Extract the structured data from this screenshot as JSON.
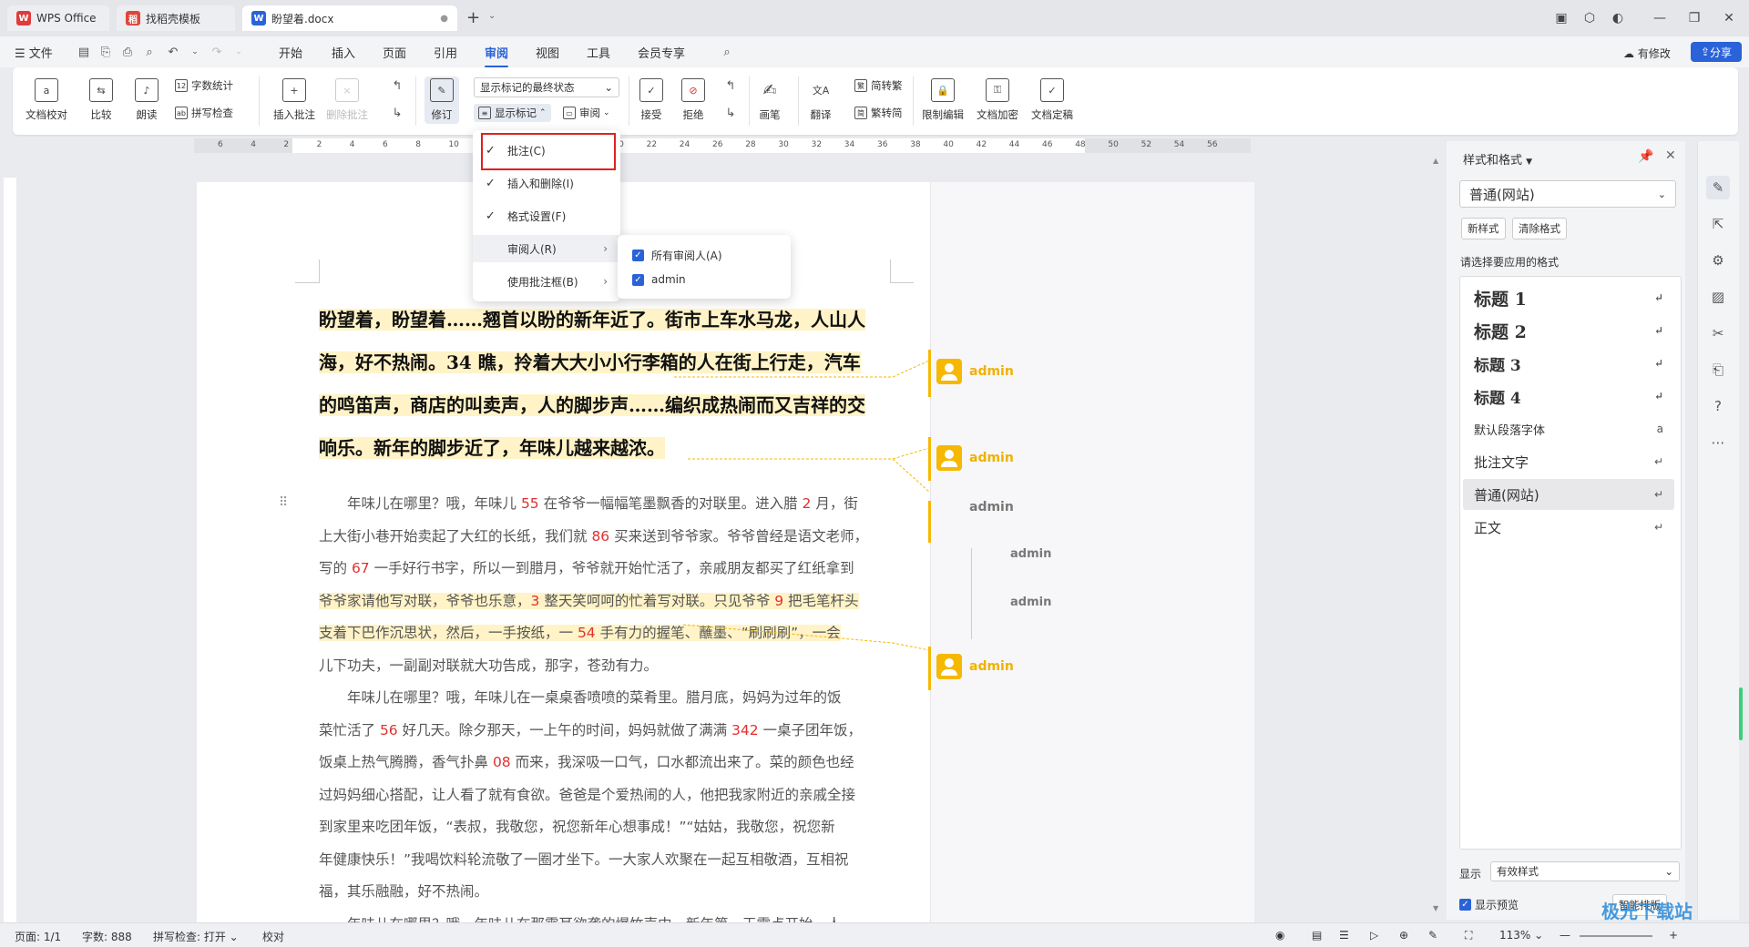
{
  "tabs": [
    {
      "label": "WPS Office",
      "icon": "wps-logo"
    },
    {
      "label": "找稻壳模板",
      "icon": "daoke-logo"
    },
    {
      "label": "盼望着.docx",
      "icon": "word-logo"
    }
  ],
  "tab_new": "+",
  "menu": {
    "file": "文件",
    "items": [
      "开始",
      "插入",
      "页面",
      "引用",
      "审阅",
      "视图",
      "工具",
      "会员专享"
    ],
    "active": "审阅",
    "has_changes": "有修改",
    "share": "分享"
  },
  "ribbon": {
    "doc_proofread": "文档校对",
    "compare": "比较",
    "read_aloud": "朗读",
    "word_count": "字数统计",
    "spell_check": "拼写检查",
    "insert_comment": "插入批注",
    "delete_comment": "删除批注",
    "track": "修订",
    "display_select": "显示标记的最终状态",
    "show_markup": "显示标记",
    "review": "审阅",
    "accept": "接受",
    "reject": "拒绝",
    "pen": "画笔",
    "translate": "翻译",
    "to_trad": "简转繁",
    "to_simp": "繁转简",
    "restrict_edit": "限制编辑",
    "doc_encrypt": "文档加密",
    "doc_finalize": "文档定稿"
  },
  "ruler_numbers": [
    "6",
    "4",
    "2",
    "2",
    "4",
    "6",
    "8",
    "10",
    "12",
    "14",
    "16",
    "18",
    "20",
    "22",
    "24",
    "26",
    "28",
    "30",
    "32",
    "34",
    "36",
    "38",
    "40",
    "42",
    "44",
    "46",
    "48",
    "50",
    "52",
    "54",
    "56"
  ],
  "dropdown": {
    "items": [
      {
        "label": "批注(C)",
        "checked": true
      },
      {
        "label": "插入和删除(I)",
        "checked": true
      },
      {
        "label": "格式设置(F)",
        "checked": true
      },
      {
        "label": "审阅人(R)",
        "checked": false,
        "submenu": true
      },
      {
        "label": "使用批注框(B)",
        "checked": false,
        "submenu": true
      }
    ],
    "submenu": [
      {
        "label": "所有审阅人(A)",
        "checked": true
      },
      {
        "label": "admin",
        "checked": true
      }
    ]
  },
  "document": {
    "heading_lines": [
      "盼望着，盼望着……翘首以盼的新年近了。街市上车水马龙，人山人",
      "海，好不热闹。34 瞧，拎着大大小小行李箱的人在街上行走，汽车",
      "的鸣笛声，商店的叫卖声，人的脚步声……编织成热闹而又吉祥的交",
      "响乐。新年的脚步近了，年味儿越来越浓。"
    ],
    "body_lines": [
      [
        "　　年味儿在哪里？哦，年味儿 ",
        "55",
        " 在爷爷一幅幅笔墨飘香的对联里。进入腊 ",
        "2",
        " 月，街"
      ],
      [
        "上大街小巷开始卖起了大红的长纸，我们就 ",
        "86",
        " 买来送到爷爷家。爷爷曾经是语文老师，"
      ],
      [
        "写的 ",
        "67",
        " 一手好行书字，所以一到腊月，爷爷就开始忙活了，亲戚朋友都买了红纸拿到"
      ],
      [
        "爷爷家请他写对联，爷爷也乐意，",
        "3",
        " 整天笑呵呵的忙着写对联。只见爷爷 ",
        "9",
        " 把毛笔杆头"
      ],
      [
        "支着下巴作沉思状，然后，一手按纸，一 ",
        "54",
        " 手有力的握笔、蘸墨、“刷刷刷”，一会"
      ],
      [
        "儿下功夫，一副副对联就大功告成，那字，苍劲有力。"
      ],
      [
        "　　年味儿在哪里？哦，年味儿在一桌桌香喷喷的菜肴里。腊月底，妈妈为过年的饭"
      ],
      [
        "菜忙活了 ",
        "56",
        " 好几天。除夕那天，一上午的时间，妈妈就做了满满 ",
        "342",
        " 一桌子团年饭，"
      ],
      [
        "饭桌上热气腾腾，香气扑鼻 ",
        "08",
        " 而来，我深吸一口气，口水都流出来了。菜的颜色也经"
      ],
      [
        "过妈妈细心搭配，让人看了就有食欲。爸爸是个爱热闹的人，他把我家附近的亲戚全接"
      ],
      [
        "到家里来吃团年饭，“表叔，我敬您，祝您新年心想事成！”“姑姑，我敬您，祝您新"
      ],
      [
        "年健康快乐！”我喝饮料轮流敬了一圈才坐下。一大家人欢聚在一起互相敬酒，互相祝"
      ],
      [
        "福，其乐融融，好不热闹。"
      ],
      [
        "　　年味儿在哪里？哦，年味儿在那震耳欲聋的爆竹声中。新年第一天零点开始，人"
      ]
    ]
  },
  "comments": [
    {
      "author": "admin",
      "style": "avatar"
    },
    {
      "author": "admin",
      "style": "avatar"
    },
    {
      "author": "admin",
      "style": "plain"
    },
    {
      "author": "admin",
      "style": "reply"
    },
    {
      "author": "admin",
      "style": "reply"
    },
    {
      "author": "admin",
      "style": "avatar"
    }
  ],
  "styles_panel": {
    "title": "样式和格式",
    "current_style": "普通(网站)",
    "new_style": "新样式",
    "clear_format": "清除格式",
    "prompt": "请选择要应用的格式",
    "styles": [
      "标题  1",
      "标题  2",
      "标题  3",
      "标题  4",
      "默认段落字体",
      "批注文字",
      "普通(网站)",
      "正文"
    ],
    "selected_style": "普通(网站)",
    "display_label": "显示",
    "display_value": "有效样式",
    "preview_label": "显示预览",
    "smart_layout": "智能排版"
  },
  "status": {
    "page": "页面: 1/1",
    "words": "字数: 888",
    "spell": "拼写检查: 打开",
    "proof": "校对",
    "zoom": "113%"
  },
  "watermark": "极光下载站",
  "colors": {
    "accent": "#2a62d8",
    "highlight": "#fff3c7",
    "comment": "#f6b800",
    "red_box": "#e02020"
  }
}
